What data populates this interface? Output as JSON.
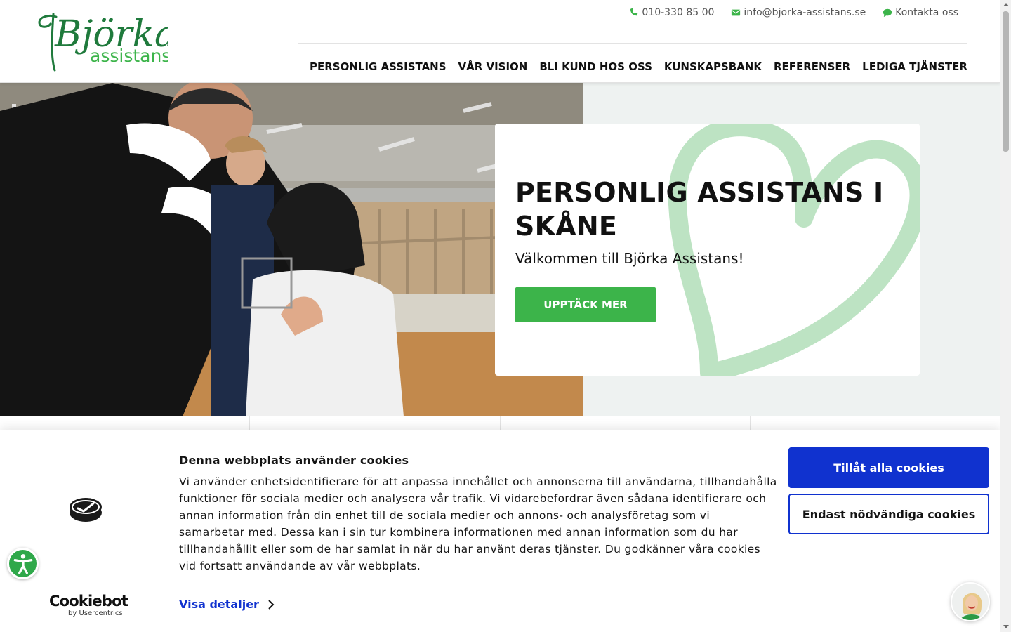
{
  "brand": {
    "logo_line1": "Björka",
    "logo_line2": "assistans",
    "color": "#1f7a3c"
  },
  "topbar": {
    "phone": "010-330 85 00",
    "email": "info@bjorka-assistans.se",
    "contact": "Kontakta oss",
    "icon_color": "#3cb44a"
  },
  "nav": {
    "items": [
      {
        "label": "PERSONLIG ASSISTANS"
      },
      {
        "label": "VÅR VISION"
      },
      {
        "label": "BLI KUND HOS OSS"
      },
      {
        "label": "KUNSKAPSBANK"
      },
      {
        "label": "REFERENSER"
      },
      {
        "label": "LEDIGA TJÄNSTER"
      }
    ]
  },
  "hero": {
    "title": "PERSONLIG ASSISTANS I SKÅNE",
    "subtitle": "Välkommen till Björka Assistans!",
    "cta": "UPPTÄCK MER",
    "accent": "#3cb44a",
    "heart_color": "#b9e1c0"
  },
  "cookie": {
    "title": "Denna webbplats använder cookies",
    "text": "Vi använder enhetsidentifierare för att anpassa innehållet och annonserna till användarna, tillhandahålla funktioner för sociala medier och analysera vår trafik. Vi vidarebefordrar även sådana identifierare och annan information från din enhet till de sociala medier och annons- och analysföretag som vi samarbetar med. Dessa kan i sin tur kombinera informationen med annan information som du har tillhandahållit eller som de har samlat in när du har använt deras tjänster. Du godkänner våra cookies vid fortsatt användande av vår webbplats.",
    "details_link": "Visa detaljer",
    "allow_all": "Tillåt alla cookies",
    "necessary_only": "Endast nödvändiga cookies",
    "provider_name": "Cookiebot",
    "provider_by": "by Usercentrics",
    "button_color": "#1032cf"
  },
  "widgets": {
    "accessibility_icon": "accessibility-icon",
    "chat_icon": "chat-avatar-icon"
  }
}
